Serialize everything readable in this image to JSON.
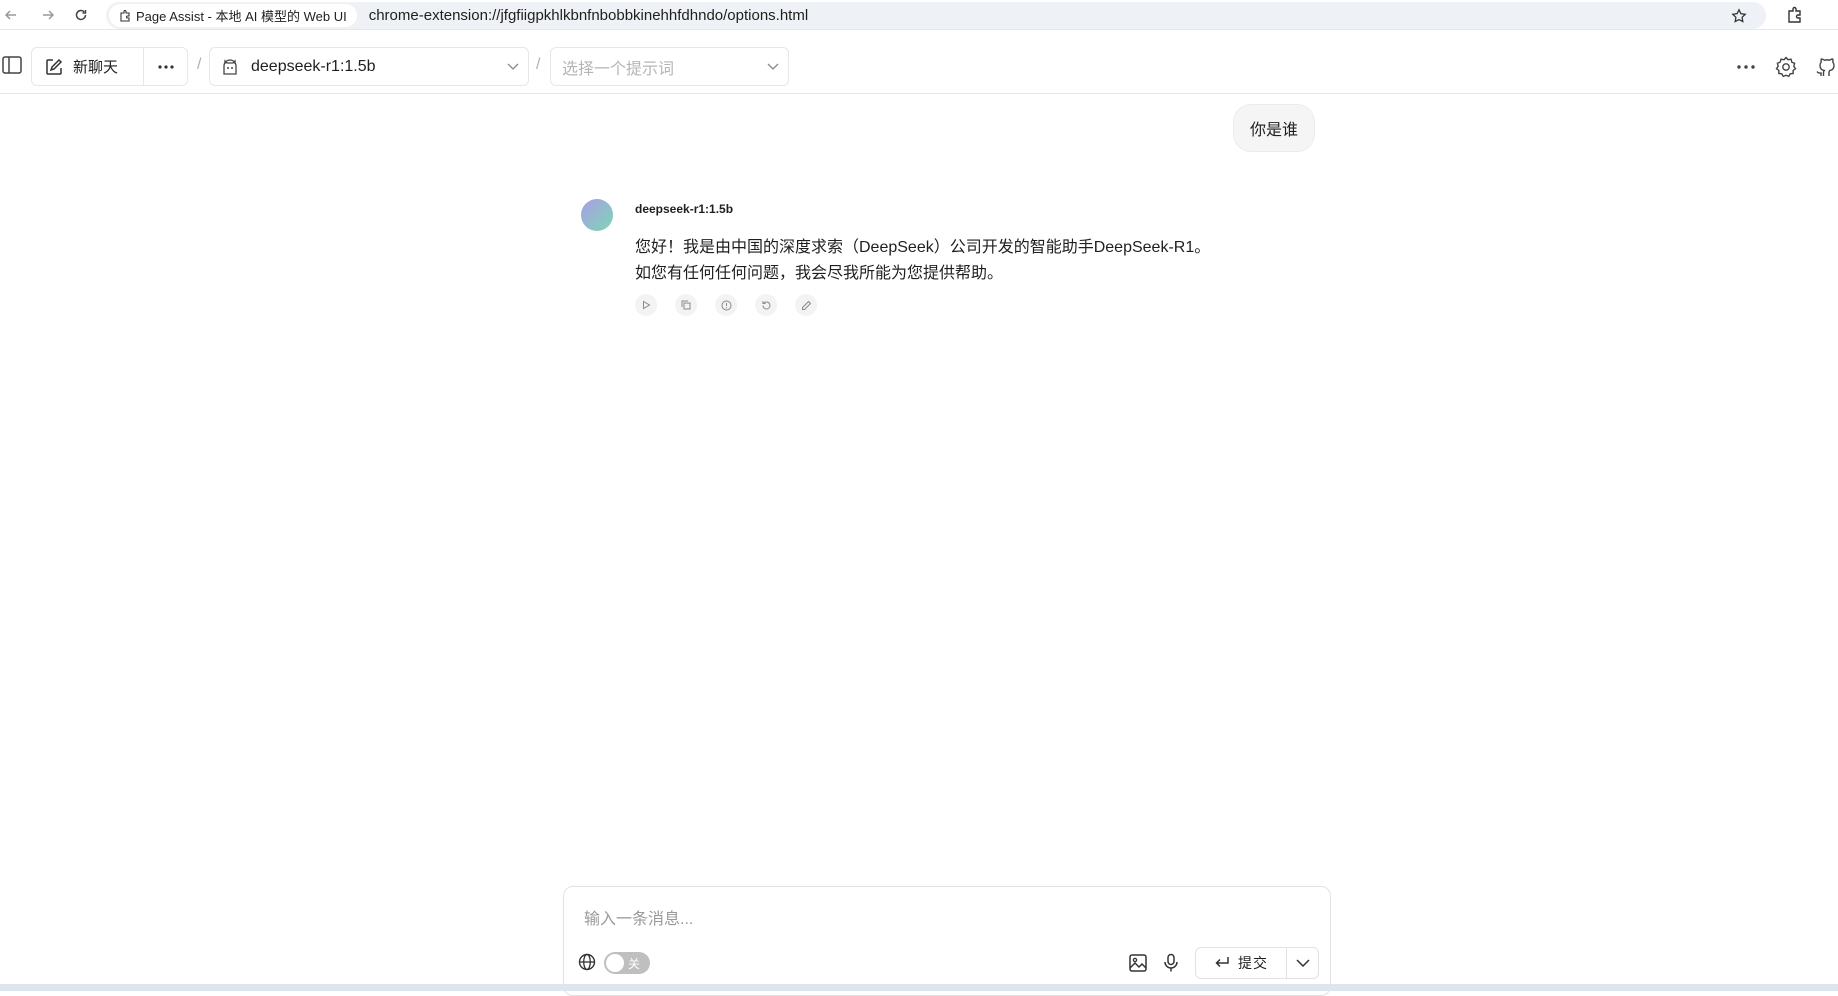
{
  "browser": {
    "tab_title": "Page Assist - 本地 AI 模型的 Web UI",
    "url": "chrome-extension://jfgfiigpkhlkbnfnbobbkinehhfdhndo/options.html"
  },
  "header": {
    "new_chat_label": "新聊天",
    "model_selected": "deepseek-r1:1.5b",
    "prompt_placeholder": "选择一个提示词",
    "separator": "/"
  },
  "chat": {
    "user_message": "你是谁",
    "bot_name": "deepseek-r1:1.5b",
    "bot_line1": "您好！我是由中国的深度求索（DeepSeek）公司开发的智能助手DeepSeek-R1。",
    "bot_line2": "如您有任何任何问题，我会尽我所能为您提供帮助。",
    "actions": [
      "play-icon",
      "copy-icon",
      "info-icon",
      "regenerate-icon",
      "edit-icon"
    ]
  },
  "composer": {
    "placeholder": "输入一条消息...",
    "web_search_toggle_label": "关",
    "web_search_enabled": false,
    "submit_label": "提交"
  },
  "colors": {
    "border": "#e5e7eb",
    "user_bubble_bg": "#f5f5f5",
    "toggle_off": "#bfbfbf",
    "avatar_gradient": [
      "#a99ee8",
      "#7dd6b3"
    ]
  }
}
